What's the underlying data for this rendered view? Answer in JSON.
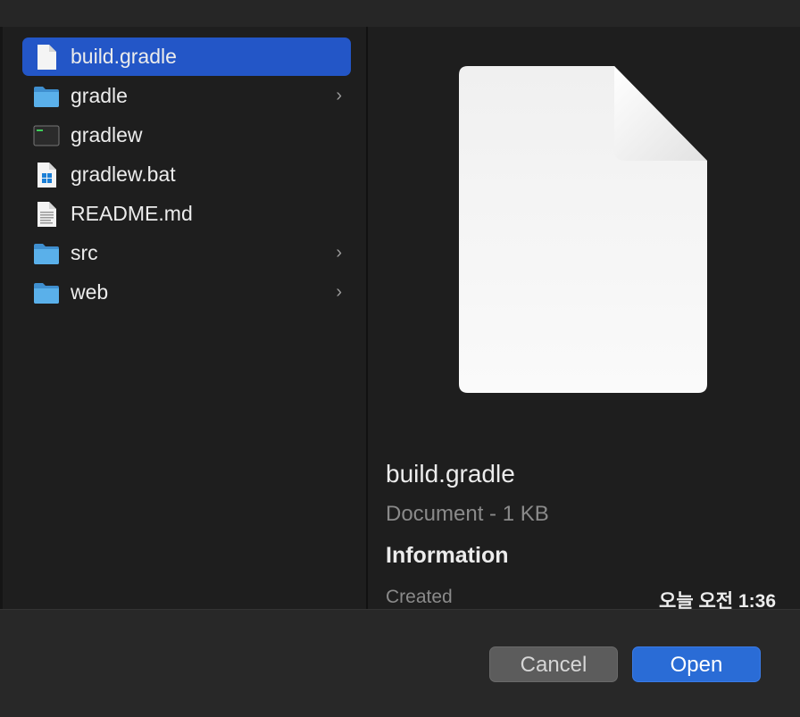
{
  "files": [
    {
      "name": "build.gradle",
      "icon": "document-icon",
      "folder": false,
      "selected": true
    },
    {
      "name": "gradle",
      "icon": "folder-icon",
      "folder": true,
      "selected": false
    },
    {
      "name": "gradlew",
      "icon": "terminal-executable-icon",
      "folder": false,
      "selected": false
    },
    {
      "name": "gradlew.bat",
      "icon": "windows-batch-icon",
      "folder": false,
      "selected": false
    },
    {
      "name": "README.md",
      "icon": "text-document-icon",
      "folder": false,
      "selected": false
    },
    {
      "name": "src",
      "icon": "folder-icon",
      "folder": true,
      "selected": false
    },
    {
      "name": "web",
      "icon": "folder-icon",
      "folder": true,
      "selected": false
    }
  ],
  "preview": {
    "file_name": "build.gradle",
    "kind": "Document - 1 KB",
    "info_header": "Information",
    "created_label": "Created",
    "created_value": "오늘 오전 1:36"
  },
  "buttons": {
    "cancel": "Cancel",
    "open": "Open"
  },
  "colors": {
    "selection": "#2356c7",
    "open_button": "#2a6cd6",
    "folder": "#5ab0ea"
  }
}
